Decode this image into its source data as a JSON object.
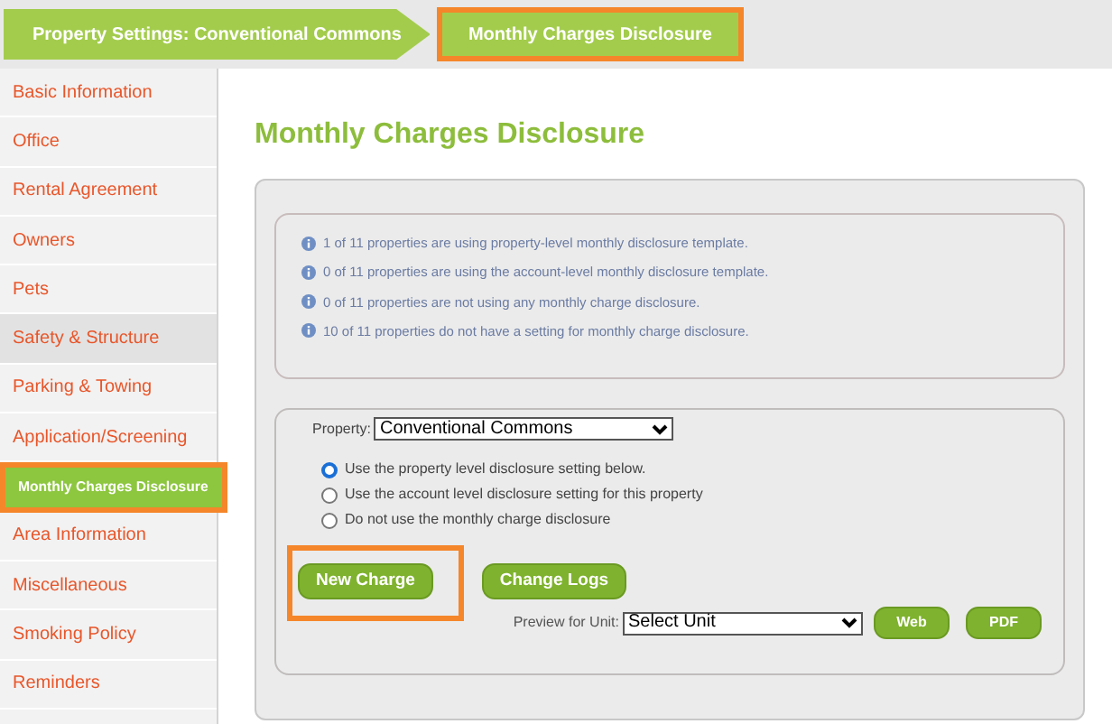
{
  "breadcrumb": [
    {
      "label": "Property Settings: Conventional Commons",
      "current": false
    },
    {
      "label": "Monthly Charges Disclosure",
      "current": true
    }
  ],
  "sidebar": {
    "items": [
      {
        "label": "Basic Information",
        "selected": false,
        "hovered": false
      },
      {
        "label": "Office",
        "selected": false,
        "hovered": false
      },
      {
        "label": "Rental Agreement",
        "selected": false,
        "hovered": false
      },
      {
        "label": "Owners",
        "selected": false,
        "hovered": false
      },
      {
        "label": "Pets",
        "selected": false,
        "hovered": false
      },
      {
        "label": "Safety & Structure",
        "selected": false,
        "hovered": true
      },
      {
        "label": "Parking & Towing",
        "selected": false,
        "hovered": false
      },
      {
        "label": "Application/Screening",
        "selected": false,
        "hovered": false
      },
      {
        "label": "Monthly Charges Disclosure",
        "selected": true,
        "hovered": false
      },
      {
        "label": "Area Information",
        "selected": false,
        "hovered": false
      },
      {
        "label": "Miscellaneous",
        "selected": false,
        "hovered": false
      },
      {
        "label": "Smoking Policy",
        "selected": false,
        "hovered": false
      },
      {
        "label": "Reminders",
        "selected": false,
        "hovered": false
      }
    ]
  },
  "page_title": "Monthly Charges Disclosure",
  "info_lines": [
    "1 of 11 properties are using property-level monthly disclosure template.",
    "0 of 11 properties are using the account-level monthly disclosure template.",
    "0 of 11 properties are not using any monthly charge disclosure.",
    "10 of 11 properties do not have a setting for monthly charge disclosure."
  ],
  "property": {
    "label": "Property:",
    "value": "Conventional Commons"
  },
  "options": [
    {
      "label": "Use the property level disclosure setting below.",
      "selected": true
    },
    {
      "label": "Use the account level disclosure setting for this property",
      "selected": false
    },
    {
      "label": "Do not use the monthly charge disclosure",
      "selected": false
    }
  ],
  "buttons": [
    {
      "label": "New Charge",
      "highlighted": true
    },
    {
      "label": "Change Logs",
      "highlighted": false
    }
  ],
  "preview": {
    "label": "Preview for Unit:",
    "value": "Select Unit",
    "buttons": [
      "Web",
      "PDF"
    ]
  }
}
